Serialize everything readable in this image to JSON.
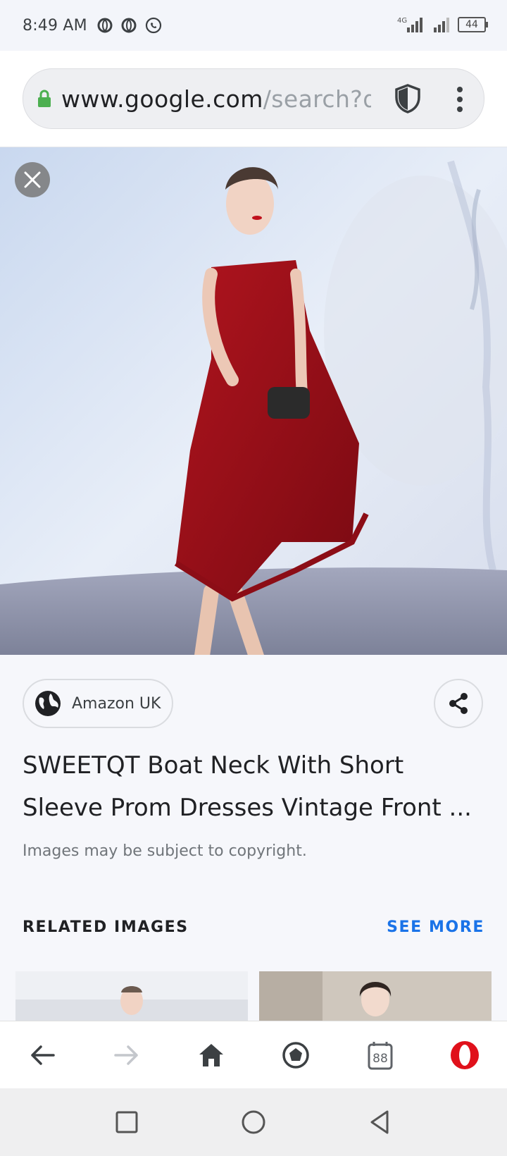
{
  "status": {
    "time": "8:49 AM",
    "network": "4G",
    "battery": "44"
  },
  "browser": {
    "url_host": "www.google.com",
    "url_path": "/search?q",
    "icons": [
      "lock-icon",
      "shield-icon",
      "more-vert-icon"
    ]
  },
  "result": {
    "source": "Amazon UK",
    "title": "SWEETQT Boat Neck With Short Sleeve Prom Dresses Vintage Front ...",
    "copyright": "Images may be subject to copyright."
  },
  "related": {
    "heading": "RELATED IMAGES",
    "see_more": "SEE MORE"
  },
  "bottom_nav": {
    "tab_count": "88",
    "items": [
      "back-icon",
      "forward-icon",
      "home-icon",
      "speed-dial-icon",
      "tabs-icon",
      "opera-menu-icon"
    ]
  },
  "colors": {
    "accent": "#1a73e8",
    "opera_red": "#e0111b",
    "lock_green": "#4caf50"
  }
}
